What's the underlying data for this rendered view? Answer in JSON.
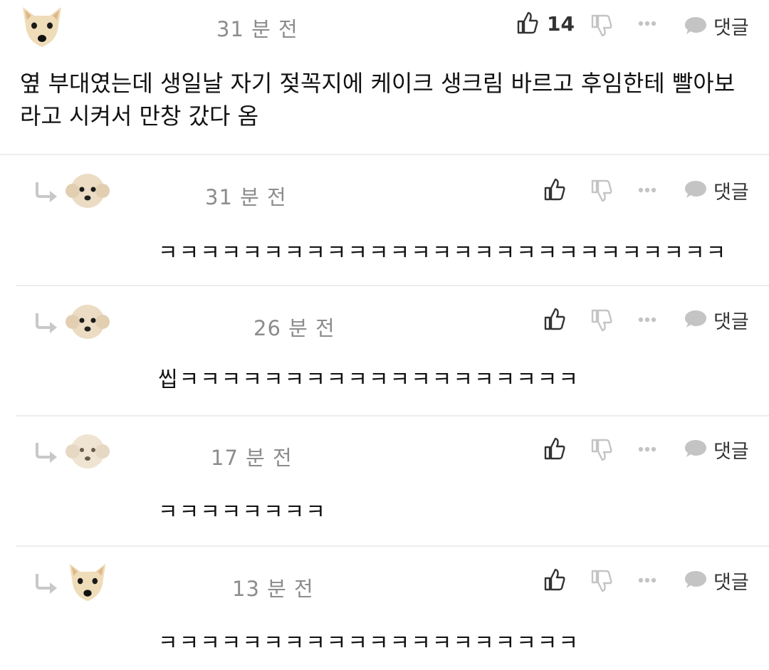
{
  "main_comment": {
    "time": "31 분 전",
    "like_count": "14",
    "reply_label": "댓글",
    "text": "옆 부대였는데 생일날 자기 젖꼭지에 케이크 생크림 바르고 후임한테 빨아보라고 시켜서 만창 갔다 옴",
    "avatar": "chihuahua-avatar"
  },
  "replies": [
    {
      "time": "31 분 전",
      "text": "ㅋㅋㅋㅋㅋㅋㅋㅋㅋㅋㅋㅋㅋㅋㅋㅋㅋㅋㅋㅋㅋㅋㅋㅋㅋㅋㅋ",
      "reply_label": "댓글",
      "avatar": "poodle-avatar"
    },
    {
      "time": "26 분 전",
      "text": "씹ㅋㅋㅋㅋㅋㅋㅋㅋㅋㅋㅋㅋㅋㅋㅋㅋㅋㅋㅋ",
      "reply_label": "댓글",
      "avatar": "poodle-avatar"
    },
    {
      "time": "17 분 전",
      "text": "ㅋㅋㅋㅋㅋㅋㅋㅋ",
      "reply_label": "댓글",
      "avatar": "poodle-avatar"
    },
    {
      "time": "13 분 전",
      "text": "ㅋㅋㅋㅋㅋㅋㅋㅋㅋㅋㅋㅋㅋㅋㅋㅋㅋㅋㅋㅋ",
      "reply_label": "댓글",
      "avatar": "chihuahua-avatar"
    }
  ],
  "icons": {
    "like": "thumbs-up-icon",
    "dislike": "thumbs-down-icon",
    "more": "more-dots-icon",
    "reply": "speech-bubble-icon",
    "reply_arrow": "reply-arrow-icon"
  },
  "colors": {
    "timestamp": "#8c8c8c",
    "icon_dark": "#333333",
    "icon_light": "#c4c4c4",
    "divider": "#ededed"
  }
}
